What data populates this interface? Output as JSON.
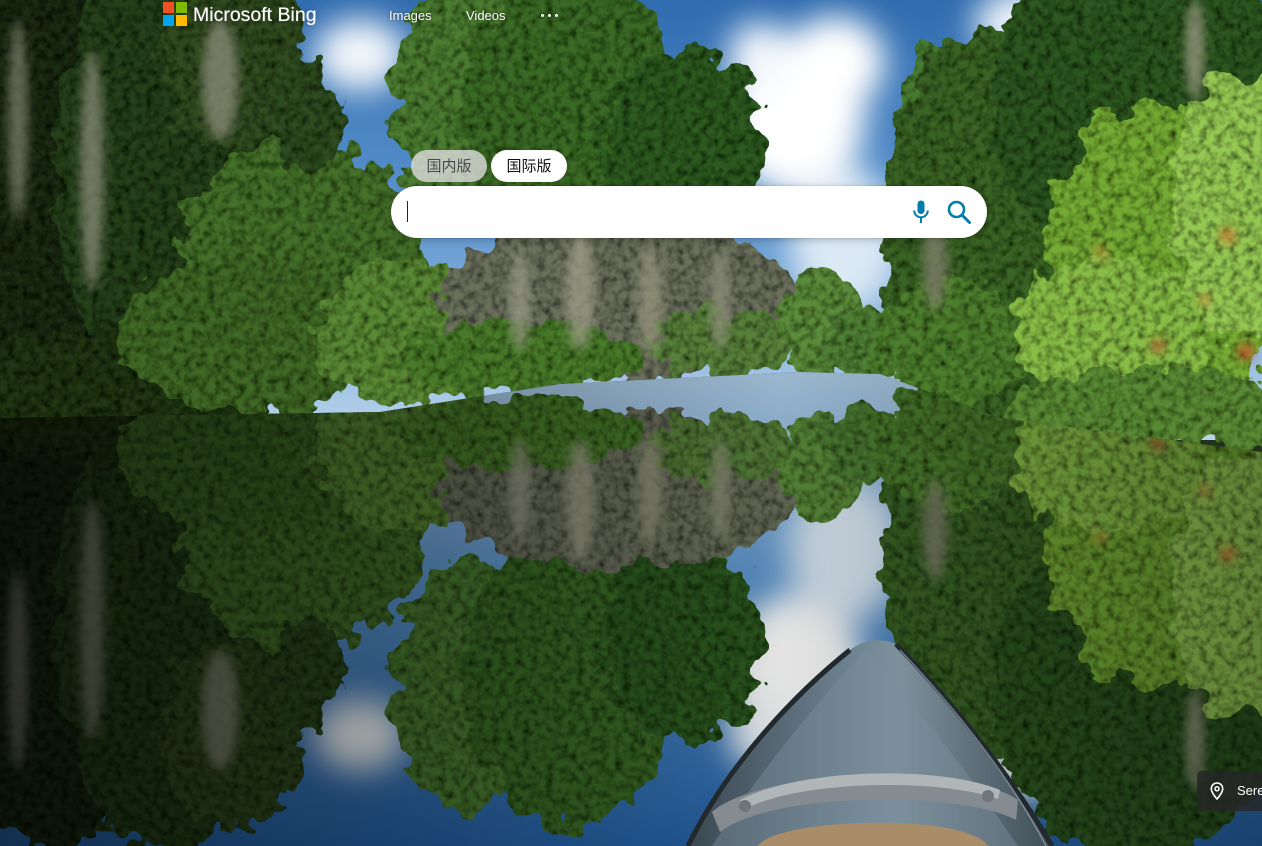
{
  "header": {
    "brand": "Microsoft Bing",
    "logo_colors": {
      "red": "#f25022",
      "green": "#7fba00",
      "blue": "#00a4ef",
      "yellow": "#ffb900"
    },
    "nav": {
      "images": "Images",
      "videos": "Videos"
    },
    "more_icon": "more-dots-icon"
  },
  "search": {
    "tabs": [
      {
        "label": "国内版",
        "selected": false
      },
      {
        "label": "国际版",
        "selected": true
      }
    ],
    "value": "",
    "accent_color": "#007daa",
    "icons": {
      "voice": "microphone-icon",
      "submit": "search-icon"
    }
  },
  "image_info": {
    "location_icon": "map-pin-icon",
    "location_label": "Sere"
  }
}
